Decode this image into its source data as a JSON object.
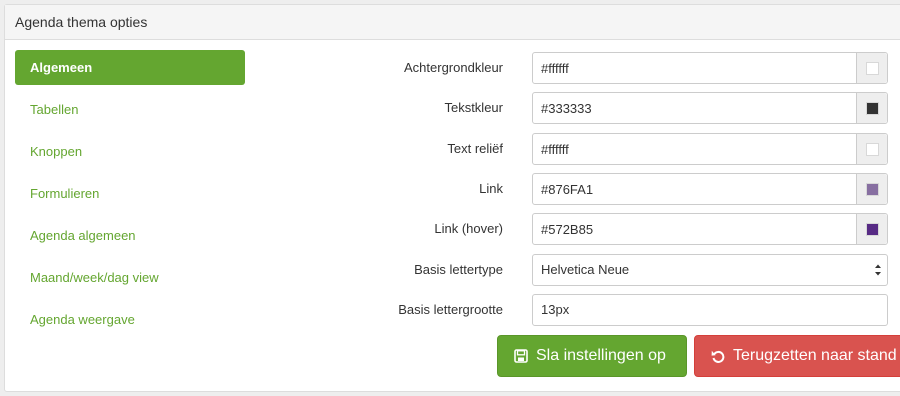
{
  "panel": {
    "title": "Agenda thema opties"
  },
  "nav": {
    "items": [
      {
        "label": "Algemeen",
        "active": true
      },
      {
        "label": "Tabellen",
        "active": false
      },
      {
        "label": "Knoppen",
        "active": false
      },
      {
        "label": "Formulieren",
        "active": false
      },
      {
        "label": "Agenda algemeen",
        "active": false
      },
      {
        "label": "Maand/week/dag view",
        "active": false
      },
      {
        "label": "Agenda weergave",
        "active": false
      }
    ]
  },
  "form": {
    "background_color": {
      "label": "Achtergrondkleur",
      "value": "#ffffff",
      "swatch": "#ffffff"
    },
    "text_color": {
      "label": "Tekstkleur",
      "value": "#333333",
      "swatch": "#333333"
    },
    "text_relief": {
      "label": "Text reliëf",
      "value": "#ffffff",
      "swatch": "#ffffff"
    },
    "link_color": {
      "label": "Link",
      "value": "#876FA1",
      "swatch": "#876FA1"
    },
    "link_hover_color": {
      "label": "Link (hover)",
      "value": "#572B85",
      "swatch": "#572B85"
    },
    "base_font": {
      "label": "Basis lettertype",
      "value": "Helvetica Neue"
    },
    "base_font_size": {
      "label": "Basis lettergrootte",
      "value": "13px"
    }
  },
  "actions": {
    "save_label": "Sla instellingen op",
    "reset_label": "Terugzetten naar stand",
    "save_icon": "floppy-disk-icon",
    "reset_icon": "undo-icon"
  },
  "colors": {
    "accent": "#64a630",
    "danger": "#d9534f"
  }
}
